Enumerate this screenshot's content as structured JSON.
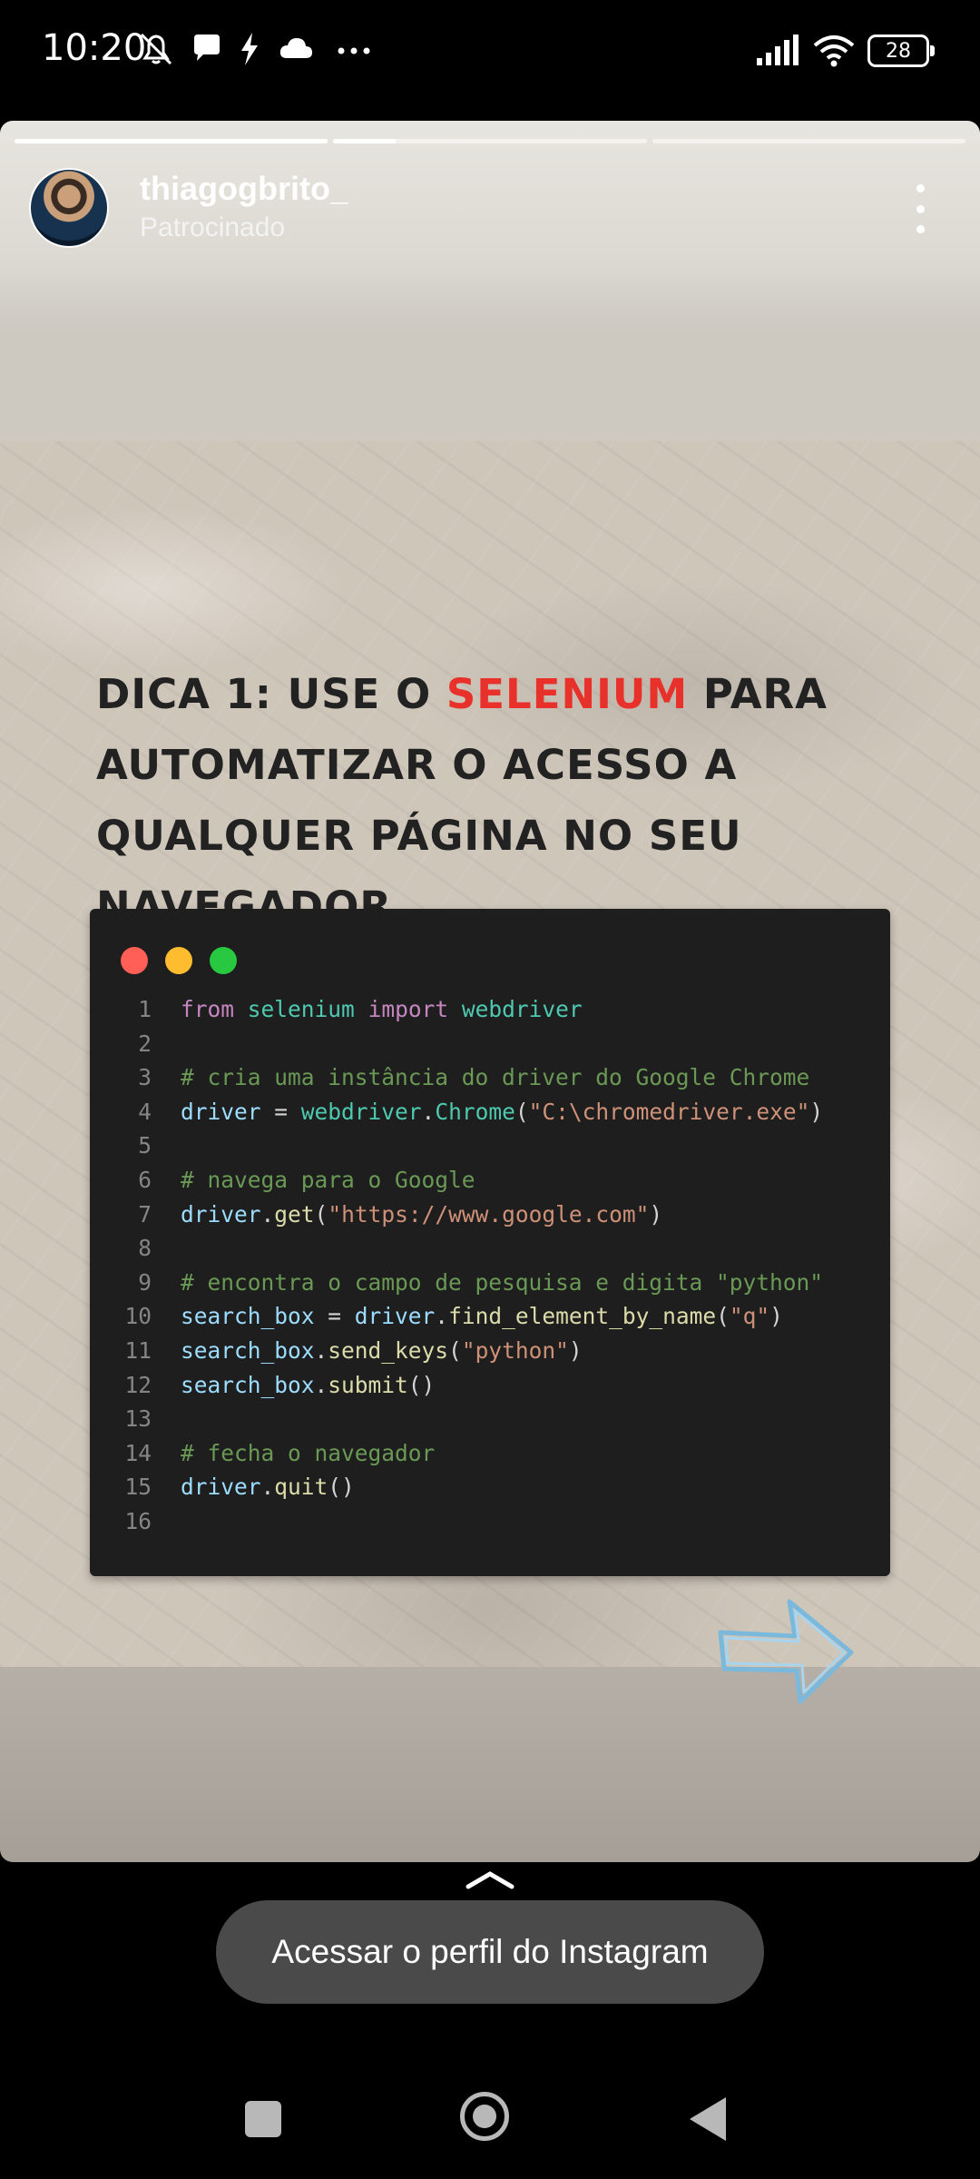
{
  "status_bar": {
    "time": "10:20",
    "battery": "28"
  },
  "story": {
    "progress": [
      1.0,
      0.2,
      0.0
    ],
    "username": "thiagogbrito_",
    "sponsored_label": "Patrocinado",
    "headline": {
      "part1": "Dica 1: use o ",
      "highlight": "Selenium",
      "part2": " para automatizar o acesso a qualquer página no seu navegador"
    },
    "code_lines": [
      {
        "n": "1",
        "tokens": [
          [
            "kw",
            "from"
          ],
          [
            "pl",
            " "
          ],
          [
            "mod",
            "selenium"
          ],
          [
            "pl",
            " "
          ],
          [
            "kw",
            "import"
          ],
          [
            "pl",
            " "
          ],
          [
            "mod",
            "webdriver"
          ]
        ]
      },
      {
        "n": "2",
        "tokens": []
      },
      {
        "n": "3",
        "tokens": [
          [
            "cm",
            "# cria uma instância do driver do Google Chrome"
          ]
        ]
      },
      {
        "n": "4",
        "tokens": [
          [
            "var",
            "driver"
          ],
          [
            "pl",
            " = "
          ],
          [
            "mod",
            "webdriver"
          ],
          [
            "pl",
            "."
          ],
          [
            "mod",
            "Chrome"
          ],
          [
            "pl",
            "("
          ],
          [
            "str",
            "\"C:\\chromedriver.exe\""
          ],
          [
            "pl",
            ")"
          ]
        ]
      },
      {
        "n": "5",
        "tokens": []
      },
      {
        "n": "6",
        "tokens": [
          [
            "cm",
            "# navega para o Google"
          ]
        ]
      },
      {
        "n": "7",
        "tokens": [
          [
            "var",
            "driver"
          ],
          [
            "pl",
            "."
          ],
          [
            "fn",
            "get"
          ],
          [
            "pl",
            "("
          ],
          [
            "str",
            "\"https://www.google.com\""
          ],
          [
            "pl",
            ")"
          ]
        ]
      },
      {
        "n": "8",
        "tokens": []
      },
      {
        "n": "9",
        "tokens": [
          [
            "cm",
            "# encontra o campo de pesquisa e digita \"python\""
          ]
        ]
      },
      {
        "n": "10",
        "tokens": [
          [
            "var",
            "search_box"
          ],
          [
            "pl",
            " = "
          ],
          [
            "var",
            "driver"
          ],
          [
            "pl",
            "."
          ],
          [
            "fn",
            "find_element_by_name"
          ],
          [
            "pl",
            "("
          ],
          [
            "str",
            "\"q\""
          ],
          [
            "pl",
            ")"
          ]
        ]
      },
      {
        "n": "11",
        "tokens": [
          [
            "var",
            "search_box"
          ],
          [
            "pl",
            "."
          ],
          [
            "fn",
            "send_keys"
          ],
          [
            "pl",
            "("
          ],
          [
            "str",
            "\"python\""
          ],
          [
            "pl",
            ")"
          ]
        ]
      },
      {
        "n": "12",
        "tokens": [
          [
            "var",
            "search_box"
          ],
          [
            "pl",
            "."
          ],
          [
            "fn",
            "submit"
          ],
          [
            "pl",
            "()"
          ]
        ]
      },
      {
        "n": "13",
        "tokens": []
      },
      {
        "n": "14",
        "tokens": [
          [
            "cm",
            "# fecha o navegador"
          ]
        ]
      },
      {
        "n": "15",
        "tokens": [
          [
            "var",
            "driver"
          ],
          [
            "pl",
            "."
          ],
          [
            "fn",
            "quit"
          ],
          [
            "pl",
            "()"
          ]
        ]
      },
      {
        "n": "16",
        "tokens": []
      }
    ],
    "window_dot_colors": [
      "#ff5f57",
      "#febc2e",
      "#28c840"
    ],
    "highlight_color": "#e8312a"
  },
  "cta": {
    "label": "Acessar o perfil do Instagram"
  }
}
